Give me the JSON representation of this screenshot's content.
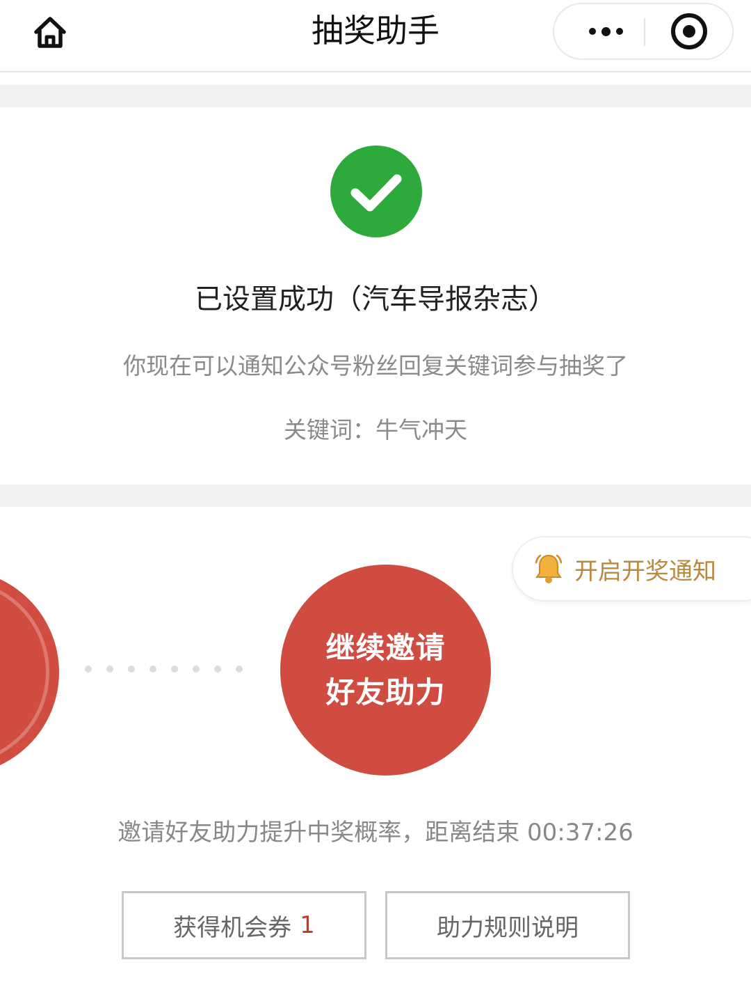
{
  "navbar": {
    "title": "抽奖助手",
    "home_icon": "home-icon",
    "more_icon": "more-dots-icon",
    "close_icon": "target-close-icon"
  },
  "success": {
    "icon": "check-circle-icon",
    "title": "已设置成功（汽车导报杂志）",
    "description": "你现在可以通知公众号粉丝回复关键词参与抽奖了",
    "keyword_line": "关键词：牛气冲天"
  },
  "invite": {
    "notify_label": "开启开奖通知",
    "notify_icon": "bell-icon",
    "circle_line1": "继续邀请",
    "circle_line2": "好友助力",
    "countdown_text": "邀请好友助力提升中奖概率，距离结束 00:37:26",
    "tickets_label": "获得机会券",
    "tickets_count": "1",
    "rules_label": "助力规则说明"
  },
  "colors": {
    "success_green": "#2eaa3d",
    "accent_red": "#d04c40",
    "notify_gold": "#b8893e",
    "count_red": "#c0392b"
  }
}
